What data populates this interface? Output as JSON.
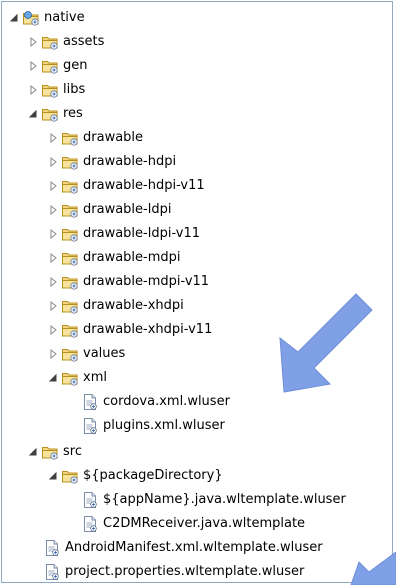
{
  "tree": {
    "root": {
      "label": "native",
      "expanded": true,
      "icon": "project-folder-icon"
    },
    "assets": {
      "label": "assets",
      "expanded": false,
      "icon": "package-folder-icon"
    },
    "gen": {
      "label": "gen",
      "expanded": false,
      "icon": "package-folder-icon"
    },
    "libs": {
      "label": "libs",
      "expanded": false,
      "icon": "package-folder-icon"
    },
    "res": {
      "label": "res",
      "expanded": true,
      "icon": "package-folder-icon",
      "children": [
        {
          "label": "drawable",
          "expanded": false
        },
        {
          "label": "drawable-hdpi",
          "expanded": false
        },
        {
          "label": "drawable-hdpi-v11",
          "expanded": false
        },
        {
          "label": "drawable-ldpi",
          "expanded": false
        },
        {
          "label": "drawable-ldpi-v11",
          "expanded": false
        },
        {
          "label": "drawable-mdpi",
          "expanded": false
        },
        {
          "label": "drawable-mdpi-v11",
          "expanded": false
        },
        {
          "label": "drawable-xhdpi",
          "expanded": false
        },
        {
          "label": "drawable-xhdpi-v11",
          "expanded": false
        },
        {
          "label": "values",
          "expanded": false
        }
      ],
      "xml": {
        "label": "xml",
        "expanded": true,
        "files": [
          {
            "label": "cordova.xml.wluser"
          },
          {
            "label": "plugins.xml.wluser"
          }
        ]
      }
    },
    "src": {
      "label": "src",
      "expanded": true,
      "package": {
        "label": "${packageDirectory}",
        "expanded": true,
        "files": [
          {
            "label": "${appName}.java.wltemplate.wluser"
          },
          {
            "label": "C2DMReceiver.java.wltemplate"
          }
        ]
      }
    },
    "root_files": [
      {
        "label": "AndroidManifest.xml.wltemplate.wluser"
      },
      {
        "label": "project.properties.wltemplate.wluser"
      }
    ]
  },
  "colors": {
    "arrow": "#7f9fe6",
    "folder": "#e8c45a",
    "border": "#8fa7bf"
  }
}
